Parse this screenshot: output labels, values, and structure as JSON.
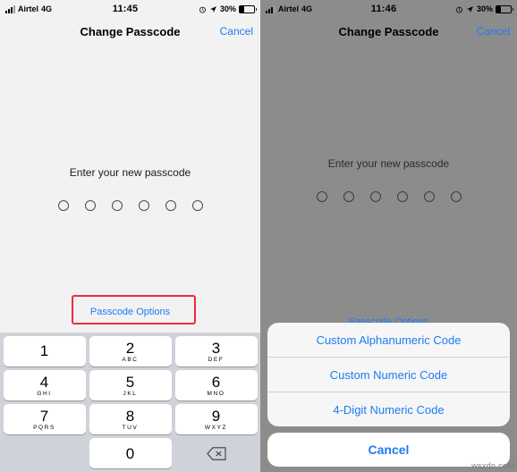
{
  "left": {
    "status": {
      "carrier": "Airtel",
      "network": "4G",
      "time": "11:45",
      "battery_pct": "30%",
      "alarm_icon": "alarm-clock-icon",
      "location_icon": "location-arrow-icon",
      "signal_icon": "signal-bars-icon",
      "battery_icon": "battery-icon"
    },
    "nav": {
      "title": "Change Passcode",
      "cancel": "Cancel"
    },
    "body": {
      "prompt": "Enter your new passcode",
      "dots": 6,
      "passcode_options": "Passcode Options"
    },
    "keypad": {
      "keys": [
        {
          "num": "1",
          "letters": ""
        },
        {
          "num": "2",
          "letters": "ABC"
        },
        {
          "num": "3",
          "letters": "DEF"
        },
        {
          "num": "4",
          "letters": "GHI"
        },
        {
          "num": "5",
          "letters": "JKL"
        },
        {
          "num": "6",
          "letters": "MNO"
        },
        {
          "num": "7",
          "letters": "PQRS"
        },
        {
          "num": "8",
          "letters": "TUV"
        },
        {
          "num": "9",
          "letters": "WXYZ"
        },
        {
          "num": "0",
          "letters": ""
        }
      ],
      "delete_icon": "backspace-delete-icon"
    }
  },
  "right": {
    "status": {
      "carrier": "Airtel",
      "network": "4G",
      "time": "11:46",
      "battery_pct": "30%",
      "alarm_icon": "alarm-clock-icon",
      "location_icon": "location-arrow-icon",
      "signal_icon": "signal-bars-icon",
      "battery_icon": "battery-icon"
    },
    "nav": {
      "title": "Change Passcode",
      "cancel": "Cancel"
    },
    "body": {
      "prompt": "Enter your new passcode",
      "dots": 6,
      "passcode_options": "Passcode Options"
    },
    "sheet": {
      "options": [
        "Custom Alphanumeric Code",
        "Custom Numeric Code",
        "4-Digit Numeric Code"
      ],
      "cancel": "Cancel"
    }
  },
  "watermark": "wsxdn.com",
  "colors": {
    "accent_blue": "#1e7bf6",
    "highlight_red": "#ef2b3d",
    "left_bg": "#f2f2f2",
    "right_bg": "#8c8c8c",
    "keypad_bg": "#cfd3d9"
  }
}
